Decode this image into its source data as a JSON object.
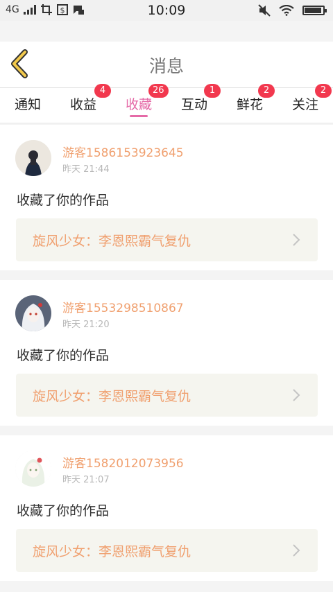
{
  "status_bar": {
    "network": "4G",
    "time": "10:09"
  },
  "header": {
    "title": "消息"
  },
  "tabs": [
    {
      "label": "通知",
      "badge": ""
    },
    {
      "label": "收益",
      "badge": "4"
    },
    {
      "label": "收藏",
      "badge": "26"
    },
    {
      "label": "互动",
      "badge": "1"
    },
    {
      "label": "鲜花",
      "badge": "2"
    },
    {
      "label": "关注",
      "badge": "2"
    }
  ],
  "colors": {
    "accent_pink": "#e56aa7",
    "name_orange": "#f0a06f",
    "badge_red": "#f2384e",
    "back_arrow": "#f2c94c"
  },
  "messages": [
    {
      "user": "游客1586153923645",
      "time": "昨天 21:44",
      "action": "收藏了你的作品",
      "work_title": "旋风少女：李恩熙霸气复仇"
    },
    {
      "user": "游客1553298510867",
      "time": "昨天 21:20",
      "action": "收藏了你的作品",
      "work_title": "旋风少女：李恩熙霸气复仇"
    },
    {
      "user": "游客1582012073956",
      "time": "昨天 21:07",
      "action": "收藏了你的作品",
      "work_title": "旋风少女：李恩熙霸气复仇"
    }
  ]
}
